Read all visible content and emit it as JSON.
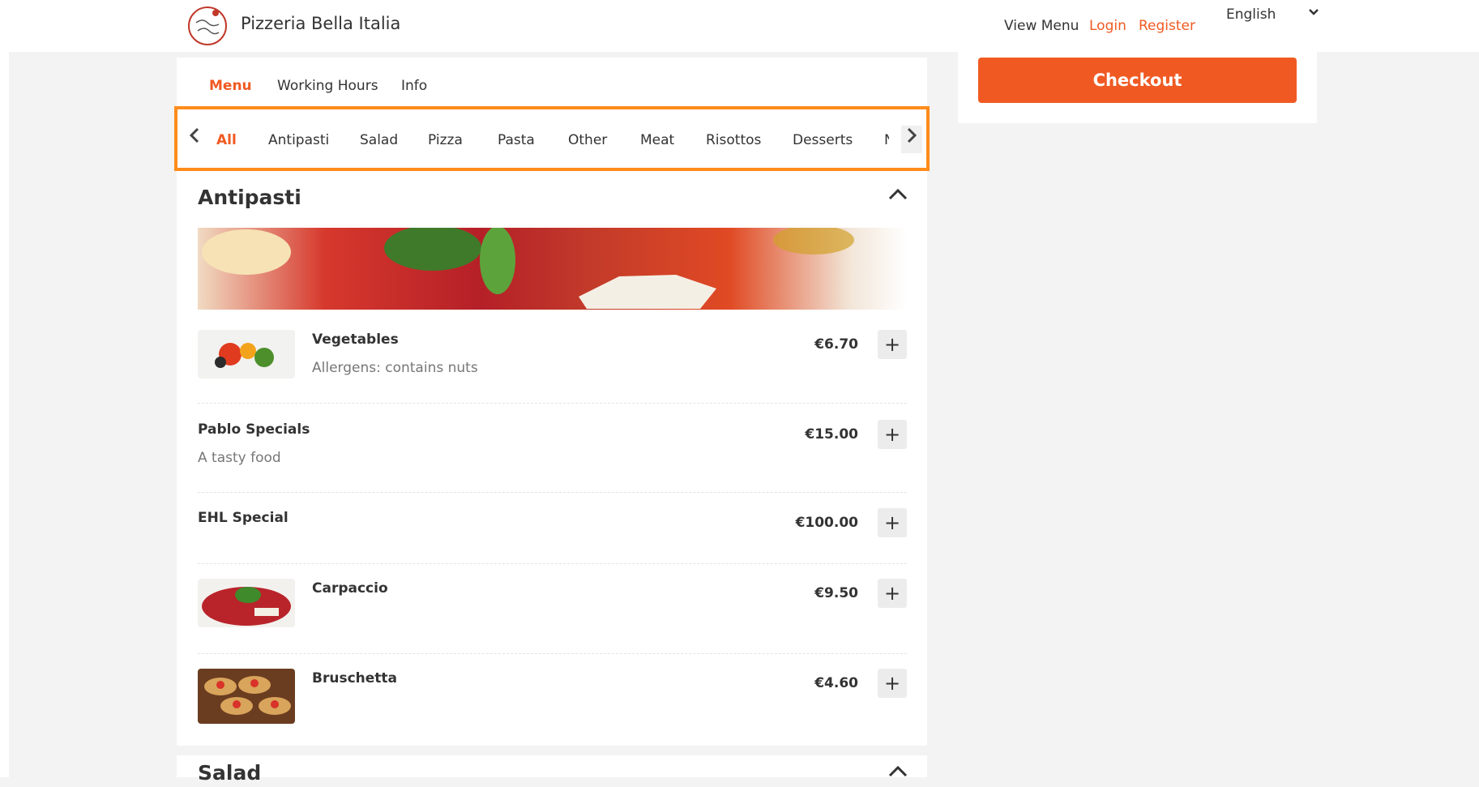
{
  "header": {
    "brand": "Pizzeria Bella Italia",
    "logo_icon": "pizzeria-bella-italia-logo",
    "nav": {
      "view_menu": "View Menu",
      "login": "Login",
      "register": "Register"
    },
    "language": "English"
  },
  "tabs": [
    "Menu",
    "Working Hours",
    "Info"
  ],
  "active_tab": "Menu",
  "categories": [
    "All",
    "Antipasti",
    "Salad",
    "Pizza",
    "Pasta",
    "Other",
    "Meat",
    "Risottos",
    "Desserts",
    "N"
  ],
  "active_category": "All",
  "sections": {
    "antipasti": {
      "title": "Antipasti",
      "items": [
        {
          "name": "Vegetables",
          "description": "Allergens: contains nuts",
          "price": "€6.70",
          "has_image": true
        },
        {
          "name": "Pablo Specials",
          "description": "A tasty food",
          "price": "€15.00",
          "has_image": false
        },
        {
          "name": "EHL Special",
          "description": "",
          "price": "€100.00",
          "has_image": false
        },
        {
          "name": "Carpaccio",
          "description": "",
          "price": "€9.50",
          "has_image": true
        },
        {
          "name": "Bruschetta",
          "description": "",
          "price": "€4.60",
          "has_image": true
        }
      ]
    },
    "salad": {
      "title": "Salad"
    }
  },
  "cart": {
    "checkout_label": "Checkout"
  },
  "colors": {
    "accent": "#f05a22",
    "highlight_border": "#ff8c1a"
  }
}
